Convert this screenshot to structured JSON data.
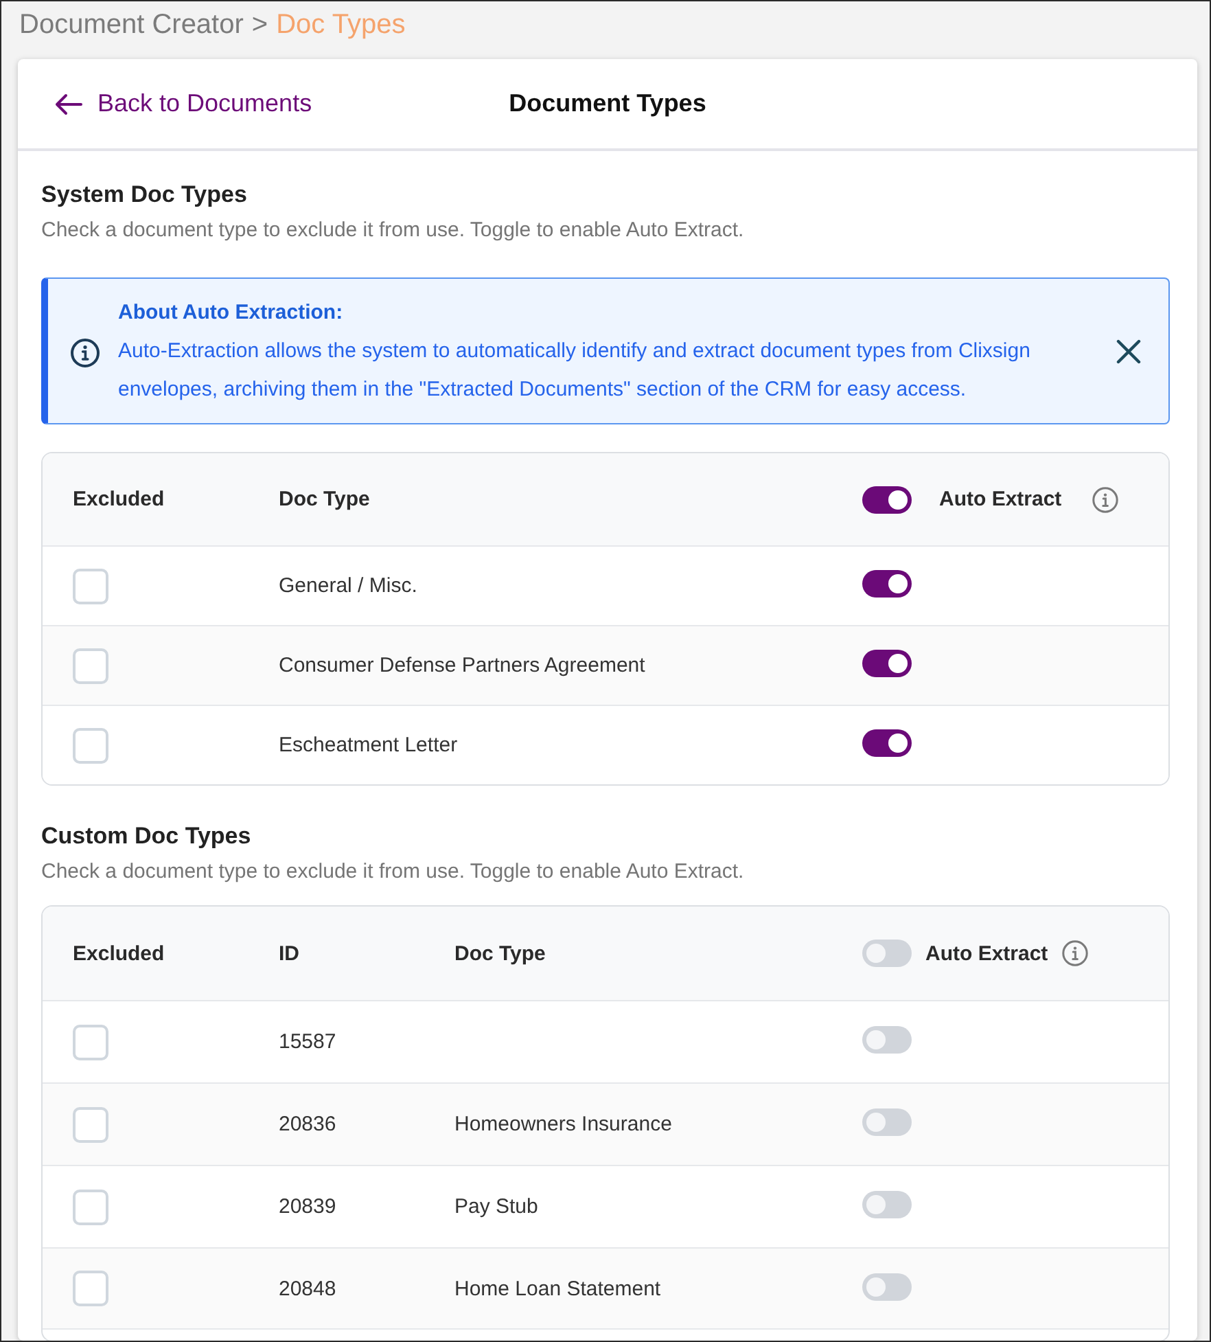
{
  "breadcrumb": {
    "items": [
      {
        "label": "Document Creator",
        "current": false
      },
      {
        "label": "Doc Types",
        "current": true
      }
    ],
    "separator": ">"
  },
  "header": {
    "back_link": "Back to Documents",
    "title": "Document Types"
  },
  "sections": [
    {
      "title": "System Doc Types",
      "description": "Check a document type to exclude it from use. Toggle to enable Auto Extract.",
      "notice": {
        "title": "About Auto Extraction:",
        "text": "Auto-Extraction allows the system to automatically identify and extract document types from Clixsign envelopes, archiving them in the \"Extracted Documents\" section of the CRM for easy access."
      },
      "table": {
        "columns": [
          {
            "kind": "text",
            "label": "Excluded"
          },
          {
            "kind": "text",
            "label": "Doc Type"
          },
          {
            "kind": "toggle",
            "label": "Auto Extract",
            "on": true
          }
        ],
        "rows": [
          {
            "cells": [
              {
                "kind": "checkbox",
                "checked": false
              },
              {
                "kind": "text",
                "text": "General / Misc."
              },
              {
                "kind": "toggle",
                "on": true
              }
            ]
          },
          {
            "cells": [
              {
                "kind": "checkbox",
                "checked": false
              },
              {
                "kind": "text",
                "text": "Consumer Defense Partners Agreement"
              },
              {
                "kind": "toggle",
                "on": true
              }
            ]
          },
          {
            "cells": [
              {
                "kind": "checkbox",
                "checked": false
              },
              {
                "kind": "text",
                "text": "Escheatment Letter"
              },
              {
                "kind": "toggle",
                "on": true
              }
            ]
          }
        ]
      }
    },
    {
      "title": "Custom Doc Types",
      "description": "Check a document type to exclude it from use. Toggle to enable Auto Extract.",
      "table": {
        "columns": [
          {
            "kind": "text",
            "label": "Excluded"
          },
          {
            "kind": "text",
            "label": "ID"
          },
          {
            "kind": "text",
            "label": "Doc Type"
          },
          {
            "kind": "toggle",
            "label": "Auto Extract",
            "on": false
          }
        ],
        "rows": [
          {
            "cells": [
              {
                "kind": "checkbox",
                "checked": false
              },
              {
                "kind": "text",
                "text": "15587"
              },
              {
                "kind": "text"
              },
              {
                "kind": "toggle",
                "on": false
              }
            ]
          },
          {
            "cells": [
              {
                "kind": "checkbox",
                "checked": false
              },
              {
                "kind": "text",
                "text": "20836"
              },
              {
                "kind": "text",
                "text": "Homeowners Insurance"
              },
              {
                "kind": "toggle",
                "on": false
              }
            ]
          },
          {
            "cells": [
              {
                "kind": "checkbox",
                "checked": false
              },
              {
                "kind": "text",
                "text": "20839"
              },
              {
                "kind": "text",
                "text": "Pay Stub"
              },
              {
                "kind": "toggle",
                "on": false
              }
            ]
          },
          {
            "cells": [
              {
                "kind": "checkbox",
                "checked": false
              },
              {
                "kind": "text",
                "text": "20848"
              },
              {
                "kind": "text",
                "text": "Home Loan Statement"
              },
              {
                "kind": "toggle",
                "on": false
              }
            ]
          }
        ]
      }
    }
  ]
}
